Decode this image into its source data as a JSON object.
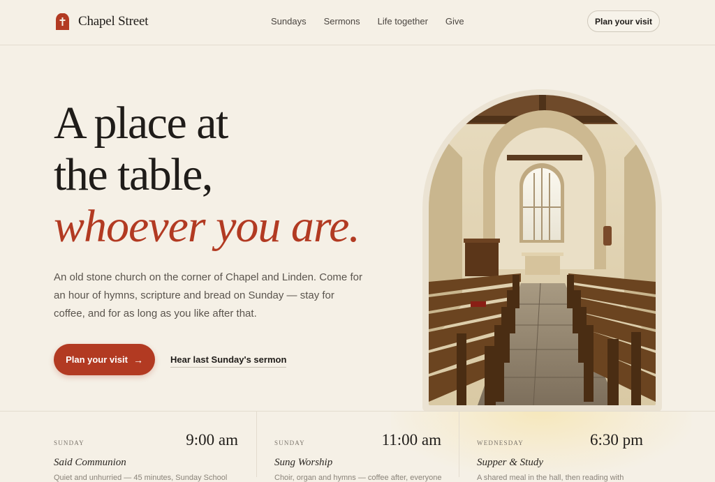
{
  "brand": {
    "name": "Chapel Street",
    "logo_icon": "church-door-cross-icon",
    "accent": "#b23a22"
  },
  "nav": {
    "items": [
      "Sundays",
      "Sermons",
      "Life together",
      "Give"
    ]
  },
  "header": {
    "cta_label": "Plan your visit"
  },
  "hero": {
    "headline_line1": "A place at",
    "headline_line2": "the table,",
    "headline_accent": "whoever you are.",
    "lede": "An old stone church on the corner of Chapel and Linden. Come for an hour of hymns, scripture and bread on Sunday — stay for coffee, and for as long as you like after that.",
    "primary_cta": "Plan your visit",
    "primary_cta_icon": "arrow-right-icon",
    "secondary_link": "Hear last Sunday's sermon",
    "image_alt": "church-interior-photo"
  },
  "services": [
    {
      "day": "SUNDAY",
      "time": "9:00 am",
      "name": "Said Communion",
      "desc": "Quiet and unhurried — 45 minutes, Sunday School"
    },
    {
      "day": "SUNDAY",
      "time": "11:00 am",
      "name": "Sung Worship",
      "desc": "Choir, organ and hymns — coffee after, everyone"
    },
    {
      "day": "WEDNESDAY",
      "time": "6:30 pm",
      "name": "Supper & Study",
      "desc": "A shared meal in the hall, then reading with"
    }
  ]
}
